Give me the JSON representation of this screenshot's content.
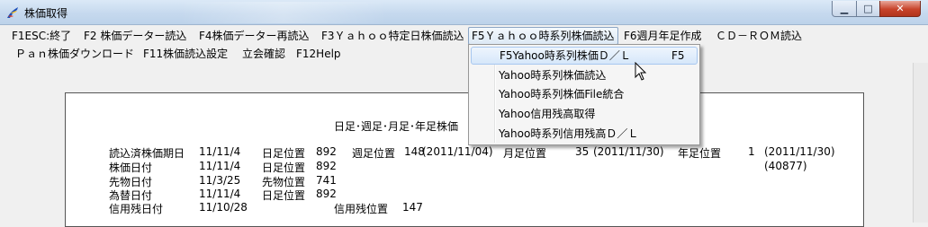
{
  "window": {
    "title": "株価取得"
  },
  "title_controls": {
    "minimize": "▁",
    "maximize": "□",
    "close": "✕"
  },
  "menu": {
    "row1": [
      "F1ESC:終了",
      "F2 株価データー読込",
      "F4株価データー再読込",
      "F3Ｙａｈｏｏ特定日株価読込",
      "F5Ｙａｈｏｏ時系列株価読込",
      "F6週月年足作成",
      "ＣＤ－ＲＯＭ読込"
    ],
    "row2": [
      "Ｐａｎ株価ダウンロード",
      "F11株価読込設定",
      "立会確認",
      "F12Help"
    ]
  },
  "dropdown": {
    "items": [
      {
        "label": "F5Yahoo時系列株価Ｄ／Ｌ",
        "shortcut": "F5"
      },
      {
        "label": "Yahoo時系列株価読込",
        "shortcut": ""
      },
      {
        "label": "Yahoo時系列株価File統合",
        "shortcut": ""
      },
      {
        "label": "Yahoo信用残高取得",
        "shortcut": ""
      },
      {
        "label": "Yahoo時系列信用残高Ｄ／Ｌ",
        "shortcut": ""
      }
    ]
  },
  "panel": {
    "heading": "日足･週足･月足･年足株価",
    "rows": [
      {
        "label": "読込済株価期日",
        "date": "11/11/4",
        "pos_label": "日足位置",
        "pos_value": "892"
      },
      {
        "label": "株価日付",
        "date": "11/11/4",
        "pos_label": "日足位置",
        "pos_value": "892"
      },
      {
        "label": "先物日付",
        "date": "11/3/25",
        "pos_label": "先物位置",
        "pos_value": "741"
      },
      {
        "label": "為替日付",
        "date": "11/11/4",
        "pos_label": "日足位置",
        "pos_value": "892"
      },
      {
        "label": "信用残日付",
        "date": "11/10/28",
        "pos_label": "信用残位置",
        "pos_value": "147"
      }
    ],
    "weekly": {
      "label": "週足位置",
      "value": "148",
      "date": "(2011/11/04)"
    },
    "monthly": {
      "label": "月足位置",
      "value": "35",
      "date": "(2011/11/30)"
    },
    "yearly": {
      "label": "年足位置",
      "value": "1",
      "date": "(2011/11/30)",
      "serial": "(40877)"
    }
  }
}
